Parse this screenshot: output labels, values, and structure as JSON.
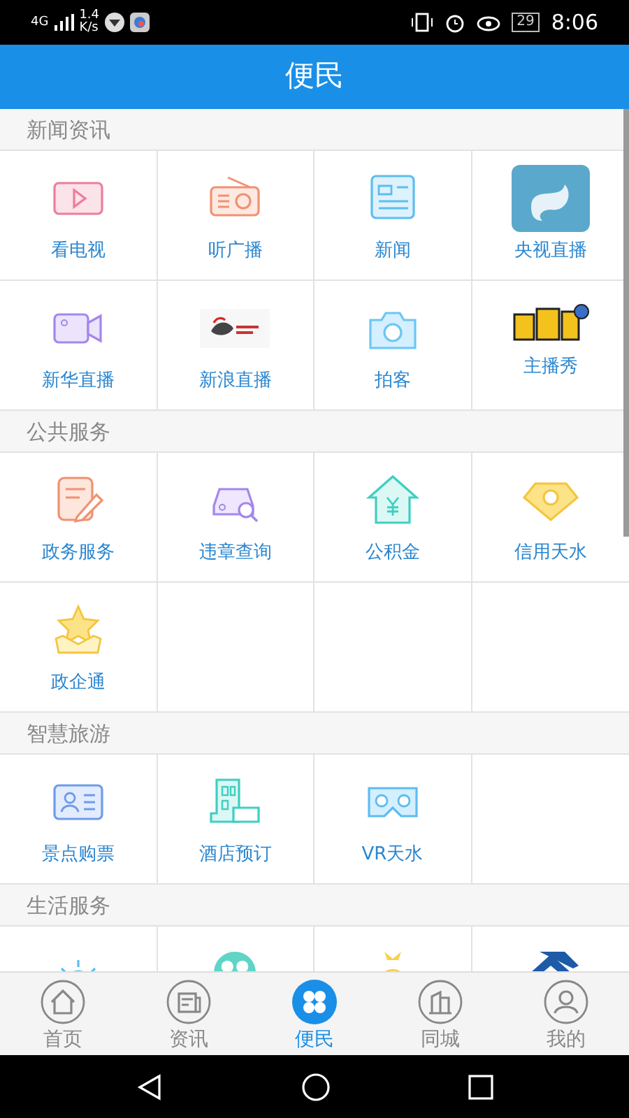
{
  "status_bar": {
    "network": "4G",
    "speed": "1.4",
    "speed_unit": "K/s",
    "battery": "29",
    "time": "8:06"
  },
  "header": {
    "title": "便民"
  },
  "sections": [
    {
      "title": "新闻资讯",
      "tiles": [
        {
          "kind": "tv",
          "label": "看电视"
        },
        {
          "kind": "radio",
          "label": "听广播"
        },
        {
          "kind": "news",
          "label": "新闻"
        },
        {
          "kind": "app",
          "label": "央视直播"
        },
        {
          "kind": "video",
          "label": "新华直播"
        },
        {
          "kind": "sina",
          "label": "新浪直播"
        },
        {
          "kind": "camera",
          "label": "拍客"
        },
        {
          "kind": "show",
          "label": "主播秀"
        }
      ]
    },
    {
      "title": "公共服务",
      "tiles": [
        {
          "kind": "edit",
          "label": "政务服务"
        },
        {
          "kind": "car",
          "label": "违章查询"
        },
        {
          "kind": "house",
          "label": "公积金"
        },
        {
          "kind": "diamond",
          "label": "信用天水"
        },
        {
          "kind": "star",
          "label": "政企通"
        }
      ]
    },
    {
      "title": "智慧旅游",
      "tiles": [
        {
          "kind": "ticket",
          "label": "景点购票"
        },
        {
          "kind": "hotel",
          "label": "酒店预订"
        },
        {
          "kind": "vr",
          "label": "VR天水"
        }
      ]
    },
    {
      "title": "生活服务",
      "tiles": [
        {
          "kind": "sun"
        },
        {
          "kind": "film"
        },
        {
          "kind": "bag"
        },
        {
          "kind": "logo"
        }
      ]
    }
  ],
  "tabs": [
    {
      "label": "首页",
      "kind": "home",
      "selected": false
    },
    {
      "label": "资讯",
      "kind": "paper",
      "selected": false
    },
    {
      "label": "便民",
      "kind": "flower",
      "selected": true
    },
    {
      "label": "同城",
      "kind": "city",
      "selected": false
    },
    {
      "label": "我的",
      "kind": "user",
      "selected": false
    }
  ]
}
